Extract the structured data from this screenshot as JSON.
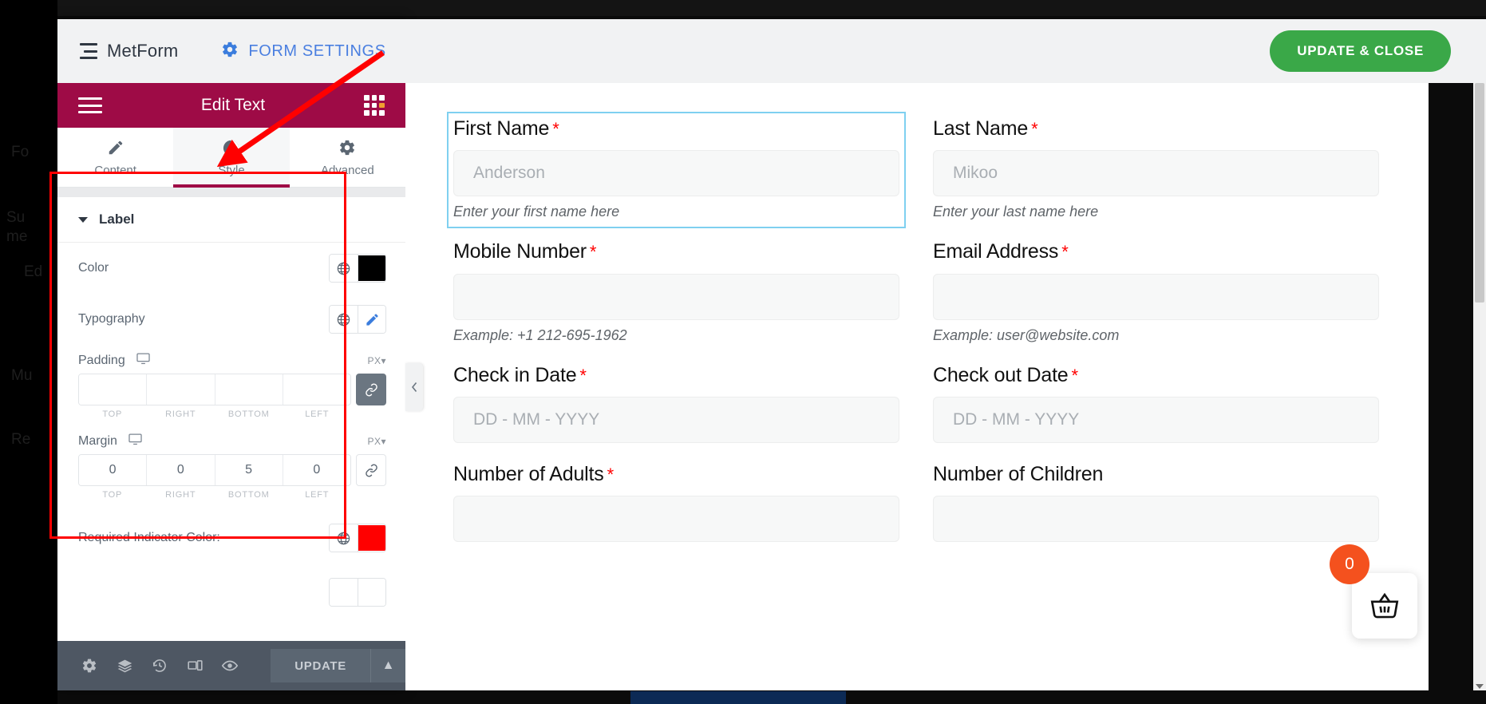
{
  "topbar": {
    "brand_label": "MetForm",
    "brand_icon": "list-icon",
    "form_settings_label": "FORM SETTINGS",
    "form_settings_icon": "gear-icon",
    "update_close_label": "UPDATE & CLOSE",
    "update_close_color": "#3aa848"
  },
  "panel": {
    "header": {
      "title": "Edit Text",
      "bg_color": "#9e0b46",
      "menu_icon": "hamburger-icon",
      "grid_icon": "widgets-grid-icon"
    },
    "tabs": [
      {
        "label": "Content",
        "icon": "pencil-icon",
        "active": false
      },
      {
        "label": "Style",
        "icon": "contrast-half-circle-icon",
        "active": true
      },
      {
        "label": "Advanced",
        "icon": "gear-icon",
        "active": false
      }
    ],
    "section": {
      "title": "Label",
      "caret_icon": "chevron-down-icon"
    },
    "controls": {
      "color": {
        "label": "Color",
        "globe_icon": "globe-icon",
        "swatch": "#000000"
      },
      "typography": {
        "label": "Typography",
        "globe_icon": "globe-icon",
        "edit_icon": "pencil-edit-icon"
      },
      "padding": {
        "label": "Padding",
        "device_icon": "desktop-monitor-icon",
        "unit": "PX",
        "unit_caret": "chevron-down-icon",
        "values": {
          "top": "",
          "right": "",
          "bottom": "",
          "left": ""
        },
        "sub_labels": [
          "TOP",
          "RIGHT",
          "BOTTOM",
          "LEFT"
        ],
        "link_icon": "link-chain-icon",
        "linked": true
      },
      "margin": {
        "label": "Margin",
        "device_icon": "desktop-monitor-icon",
        "unit": "PX",
        "unit_caret": "chevron-down-icon",
        "values": {
          "top": "0",
          "right": "0",
          "bottom": "5",
          "left": "0"
        },
        "sub_labels": [
          "TOP",
          "RIGHT",
          "BOTTOM",
          "LEFT"
        ],
        "link_icon": "link-chain-icon",
        "linked": false
      },
      "required_indicator": {
        "label": "Required Indicator Color:",
        "globe_icon": "globe-icon",
        "swatch": "#ff0000"
      }
    },
    "footer": {
      "icons": [
        "gear-settings-icon",
        "layers-navigator-icon",
        "history-revisions-icon",
        "responsive-mode-icon",
        "preview-eye-icon"
      ],
      "update_label": "UPDATE",
      "update_caret_icon": "chevron-up-icon"
    },
    "highlight_box_color": "#ff0000",
    "annotation_arrow_color": "#ff0000"
  },
  "preview": {
    "collapse_icon": "chevron-left-icon",
    "fields": [
      {
        "label": "First Name",
        "required": true,
        "value": "Anderson",
        "help": "Enter your first name here",
        "selected": true
      },
      {
        "label": "Last Name",
        "required": true,
        "value": "Mikoo",
        "help": "Enter your last name here",
        "selected": false
      },
      {
        "label": "Mobile Number",
        "required": true,
        "value": "",
        "help": "Example: +1 212-695-1962",
        "selected": false
      },
      {
        "label": "Email Address",
        "required": true,
        "value": "",
        "help": "Example: user@website.com",
        "selected": false
      },
      {
        "label": "Check in Date",
        "required": true,
        "value": "DD - MM - YYYY",
        "help": "",
        "selected": false
      },
      {
        "label": "Check out Date",
        "required": true,
        "value": "DD - MM - YYYY",
        "help": "",
        "selected": false
      },
      {
        "label": "Number of Adults",
        "required": true,
        "value": "",
        "help": "",
        "selected": false
      },
      {
        "label": "Number of Children",
        "required": false,
        "value": "",
        "help": "",
        "selected": false
      }
    ],
    "scrollbar": {
      "down_icon": "chevron-down-icon"
    }
  },
  "cart": {
    "count": "0",
    "icon": "shopping-basket-icon",
    "badge_color": "#f4511e"
  }
}
